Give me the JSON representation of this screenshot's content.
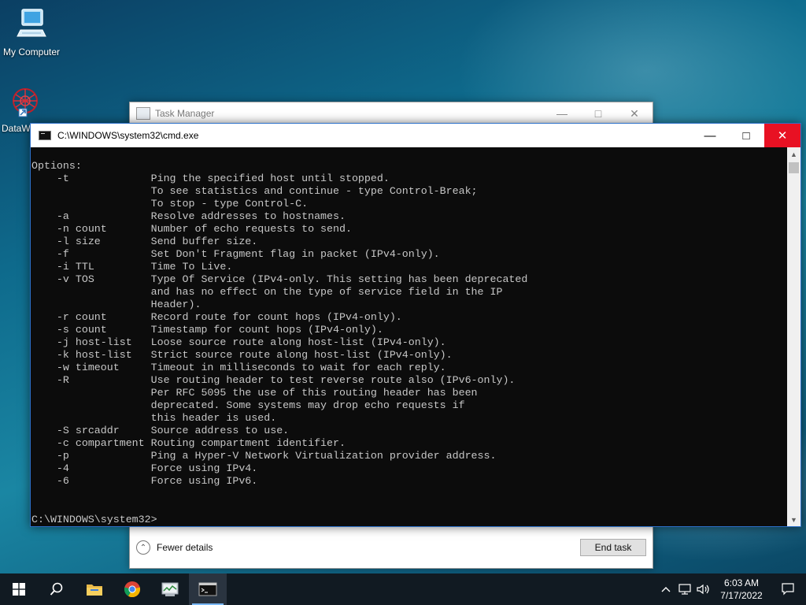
{
  "desktop": {
    "icons": [
      {
        "label": "My Computer",
        "icon": "computer-icon"
      },
      {
        "label": "DataW",
        "icon": "datawatch-icon"
      }
    ]
  },
  "task_manager": {
    "title": "Task Manager",
    "fewer_details": "Fewer details",
    "end_task": "End task"
  },
  "cmd": {
    "title": "C:\\WINDOWS\\system32\\cmd.exe",
    "output": "Options:\n    -t             Ping the specified host until stopped.\n                   To see statistics and continue - type Control-Break;\n                   To stop - type Control-C.\n    -a             Resolve addresses to hostnames.\n    -n count       Number of echo requests to send.\n    -l size        Send buffer size.\n    -f             Set Don't Fragment flag in packet (IPv4-only).\n    -i TTL         Time To Live.\n    -v TOS         Type Of Service (IPv4-only. This setting has been deprecated\n                   and has no effect on the type of service field in the IP\n                   Header).\n    -r count       Record route for count hops (IPv4-only).\n    -s count       Timestamp for count hops (IPv4-only).\n    -j host-list   Loose source route along host-list (IPv4-only).\n    -k host-list   Strict source route along host-list (IPv4-only).\n    -w timeout     Timeout in milliseconds to wait for each reply.\n    -R             Use routing header to test reverse route also (IPv6-only).\n                   Per RFC 5095 the use of this routing header has been\n                   deprecated. Some systems may drop echo requests if\n                   this header is used.\n    -S srcaddr     Source address to use.\n    -c compartment Routing compartment identifier.\n    -p             Ping a Hyper-V Network Virtualization provider address.\n    -4             Force using IPv4.\n    -6             Force using IPv6.",
    "prompt": "C:\\WINDOWS\\system32>"
  },
  "taskbar": {
    "apps": [
      {
        "name": "start",
        "icon": "windows-start-icon"
      },
      {
        "name": "search",
        "icon": "search-icon"
      },
      {
        "name": "file-explorer",
        "icon": "folder-icon"
      },
      {
        "name": "chrome",
        "icon": "chrome-icon"
      },
      {
        "name": "task-manager",
        "icon": "task-manager-icon"
      },
      {
        "name": "cmd",
        "icon": "terminal-icon",
        "active": true
      }
    ],
    "clock": {
      "time": "6:03 AM",
      "date": "7/17/2022"
    }
  },
  "colors": {
    "cmd_bg": "#0c0c0c",
    "cmd_text": "#c7c7c7",
    "close_red": "#e81123",
    "taskbar": "#111a22"
  }
}
